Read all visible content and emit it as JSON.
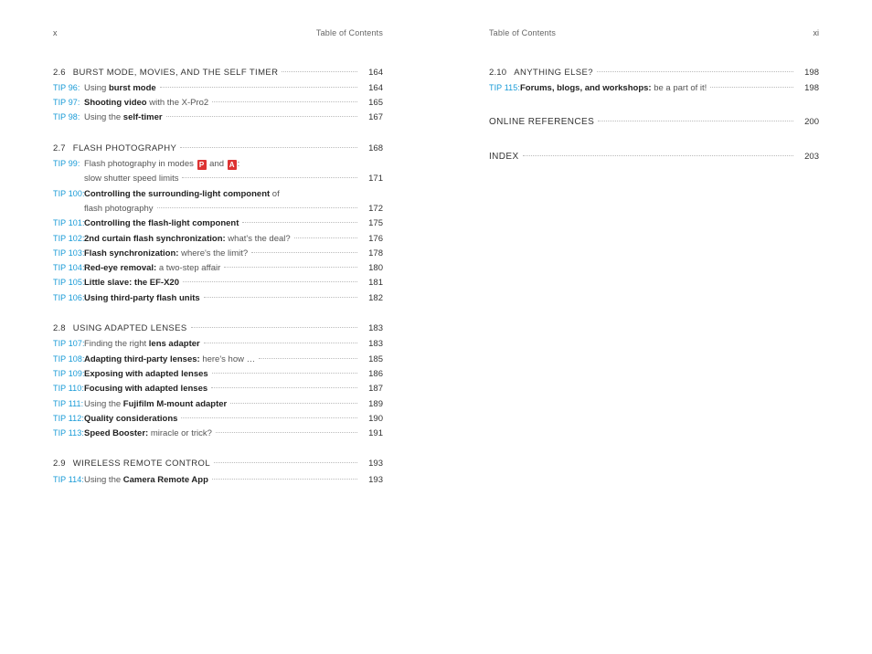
{
  "header": {
    "title": "Table of Contents",
    "left_page_num": "x",
    "right_page_num": "xi"
  },
  "left": {
    "sections": [
      {
        "num": "2.6",
        "title": "BURST MODE, MOVIES, AND THE SELF TIMER",
        "page": "164",
        "tips": [
          {
            "label": "TIP 96:",
            "text_pre": "Using ",
            "bold": "burst mode",
            "text_post": "",
            "page": "164"
          },
          {
            "label": "TIP 97:",
            "text_pre": "",
            "bold": "Shooting video",
            "text_post": " with the X-Pro2",
            "page": "165"
          },
          {
            "label": "TIP 98:",
            "text_pre": "Using the ",
            "bold": "self-timer",
            "text_post": "",
            "page": "167"
          }
        ]
      },
      {
        "num": "2.7",
        "title": "FLASH PHOTOGRAPHY",
        "page": "168",
        "tips": [
          {
            "label": "TIP 99:",
            "special": "flash_modes",
            "sub": "slow shutter speed limits",
            "page": "171"
          },
          {
            "label": "TIP 100:",
            "text_pre": "",
            "bold": "Controlling the surrounding-light component",
            "text_post": " of",
            "sub": "flash photography",
            "page": "172"
          },
          {
            "label": "TIP 101:",
            "text_pre": "",
            "bold": "Controlling the flash-light component",
            "text_post": "",
            "page": "175"
          },
          {
            "label": "TIP 102:",
            "text_pre": "",
            "bold": "2nd curtain flash synchronization:",
            "text_post": " what's the deal?",
            "page": "176"
          },
          {
            "label": "TIP 103:",
            "text_pre": "",
            "bold": "Flash synchronization:",
            "text_post": " where's the limit?",
            "page": "178"
          },
          {
            "label": "TIP 104:",
            "text_pre": "",
            "bold": "Red-eye removal:",
            "text_post": " a two-step affair",
            "page": "180"
          },
          {
            "label": "TIP 105:",
            "text_pre": "",
            "bold": "Little slave: the EF-X20",
            "text_post": "",
            "page": "181"
          },
          {
            "label": "TIP 106:",
            "text_pre": "",
            "bold": "Using third-party flash units",
            "text_post": "",
            "page": "182"
          }
        ]
      },
      {
        "num": "2.8",
        "title": "USING ADAPTED LENSES",
        "page": "183",
        "tips": [
          {
            "label": "TIP 107:",
            "text_pre": "Finding the right ",
            "bold": "lens adapter",
            "text_post": "",
            "page": "183"
          },
          {
            "label": "TIP 108:",
            "text_pre": "",
            "bold": "Adapting third-party lenses:",
            "text_post": " here's how …",
            "page": "185"
          },
          {
            "label": "TIP 109:",
            "text_pre": "",
            "bold": "Exposing with adapted lenses",
            "text_post": "",
            "page": "186"
          },
          {
            "label": "TIP 110:",
            "text_pre": "",
            "bold": "Focusing with adapted lenses",
            "text_post": "",
            "page": "187"
          },
          {
            "label": "TIP 111:",
            "text_pre": "Using the ",
            "bold": "Fujifilm M-mount adapter",
            "text_post": "",
            "page": "189"
          },
          {
            "label": "TIP 112:",
            "text_pre": "",
            "bold": "Quality considerations",
            "text_post": "",
            "page": "190"
          },
          {
            "label": "TIP 113:",
            "text_pre": "",
            "bold": "Speed Booster:",
            "text_post": " miracle or trick?",
            "page": "191"
          }
        ]
      },
      {
        "num": "2.9",
        "title": "WIRELESS REMOTE CONTROL",
        "page": "193",
        "tips": [
          {
            "label": "TIP 114:",
            "text_pre": "Using the ",
            "bold": "Camera Remote App",
            "text_post": "",
            "page": "193"
          }
        ]
      }
    ]
  },
  "right": {
    "sections": [
      {
        "num": "2.10",
        "title": "ANYTHING ELSE?",
        "page": "198",
        "tips": [
          {
            "label": "TIP 115:",
            "text_pre": "",
            "bold": "Forums, blogs, and workshops:",
            "text_post": " be a part of it!",
            "page": "198"
          }
        ]
      }
    ],
    "refs": [
      {
        "title": "ONLINE REFERENCES",
        "page": "200"
      },
      {
        "title": "INDEX",
        "page": "203"
      }
    ]
  },
  "flash_modes": {
    "pre": "Flash photography in modes ",
    "badge1": "P",
    "mid": " and ",
    "badge2": "A",
    "post": ":"
  }
}
